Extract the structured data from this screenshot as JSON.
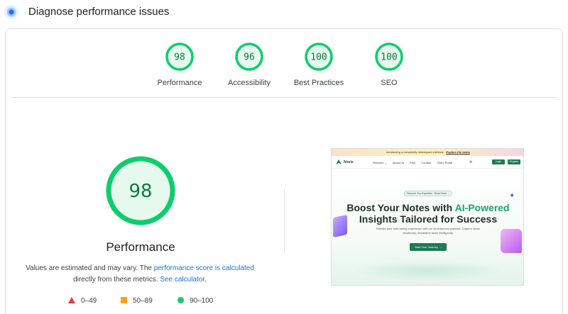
{
  "header": {
    "title": "Diagnose performance issues",
    "icon": "lighthouse-icon"
  },
  "gauges": [
    {
      "score": 98,
      "label": "Performance"
    },
    {
      "score": 96,
      "label": "Accessibility"
    },
    {
      "score": 100,
      "label": "Best Practices"
    },
    {
      "score": 100,
      "label": "SEO"
    }
  ],
  "main": {
    "score": 98,
    "title": "Performance",
    "note_prefix": "Values are estimated and may vary. The ",
    "note_link": "performance score is calculated",
    "note_middle": " directly from these metrics. ",
    "note_link2": "See calculator",
    "note_suffix": "."
  },
  "legend": [
    {
      "range": "0–49",
      "shape": "triangle",
      "color": "#eb3a35"
    },
    {
      "range": "50–89",
      "shape": "square",
      "color": "#ffa400"
    },
    {
      "range": "90–100",
      "shape": "circle",
      "color": "#0cce6b"
    }
  ],
  "colors": {
    "pass_ring": "#0cce6b",
    "pass_fill": "#e6f9ef",
    "pass_text": "#0d7a3a",
    "link": "#1a73e8"
  },
  "screenshot": {
    "banner_text": "Introducing a completely redesigned interface - ",
    "banner_link": "Explore the demo",
    "logo": "Novis",
    "nav_links": [
      "Services ⌄",
      "About Us",
      "FAQ",
      "Contact",
      "Client Portal"
    ],
    "login": "Login",
    "register": "Register",
    "pill": "Discover Our Expertise · Read More →",
    "headline_part1": "Boost Your Notes with ",
    "headline_accent": "AI-Powered",
    "headline_part2": "Insights Tailored for Success",
    "subtext": "Elevate your note-taking experience with our AI-enhanced platform. Capture ideas effortlessly, streamline tasks intelligently.",
    "cta": "Start Your Journey →"
  }
}
